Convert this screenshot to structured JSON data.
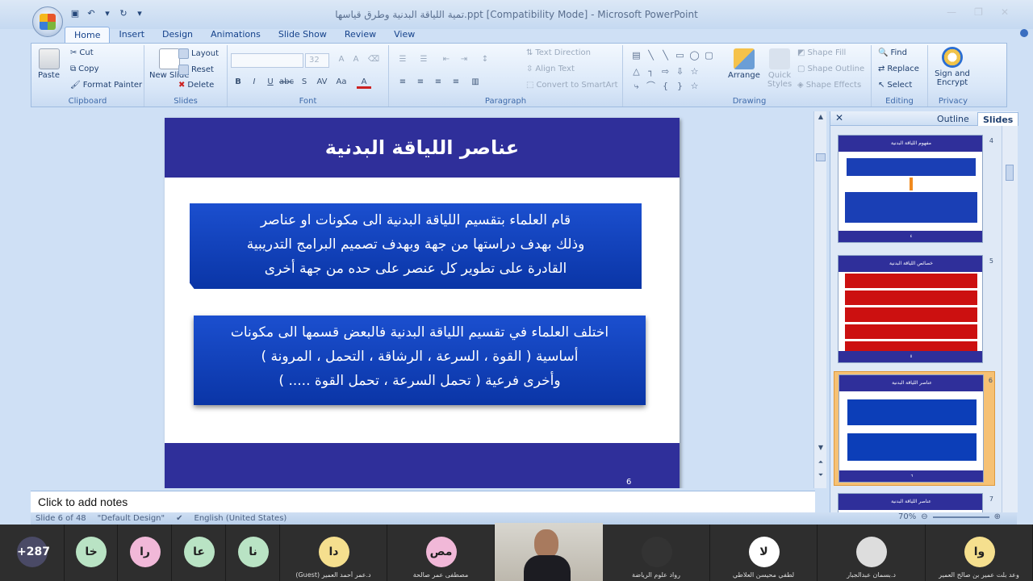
{
  "window": {
    "title": "تمية اللياقة البدنية وطرق قياسها.ppt [Compatibility Mode] - Microsoft PowerPoint"
  },
  "tabs": [
    "Home",
    "Insert",
    "Design",
    "Animations",
    "Slide Show",
    "Review",
    "View"
  ],
  "active_tab": "Home",
  "ribbon": {
    "clipboard": {
      "label": "Clipboard",
      "paste": "Paste",
      "cut": "Cut",
      "copy": "Copy",
      "format_painter": "Format Painter"
    },
    "slides": {
      "label": "Slides",
      "new_slide": "New Slide",
      "layout": "Layout",
      "reset": "Reset",
      "delete": "Delete"
    },
    "font": {
      "label": "Font",
      "size": "32"
    },
    "paragraph": {
      "label": "Paragraph",
      "text_direction": "Text Direction",
      "align_text": "Align Text",
      "convert_smartart": "Convert to SmartArt"
    },
    "drawing": {
      "label": "Drawing",
      "arrange": "Arrange",
      "quick_styles": "Quick Styles",
      "shape_fill": "Shape Fill",
      "shape_outline": "Shape Outline",
      "shape_effects": "Shape Effects"
    },
    "editing": {
      "label": "Editing",
      "find": "Find",
      "replace": "Replace",
      "select": "Select"
    },
    "privacy": {
      "label": "Privacy",
      "sign_encrypt": "Sign and Encrypt"
    }
  },
  "slide": {
    "title": "عناصر اللياقة البدنية",
    "box1_lines": [
      "قام العلماء بتقسيم اللياقة البدنية الى مكونات او عناصر",
      "وذلك بهدف دراستها من جهة وبهدف تصميم البرامج التدريبية",
      "القادرة على تطوير كل عنصر على حده  من جهة أخرى"
    ],
    "box2_lines": [
      "اختلف العلماء في تقسيم اللياقة البدنية فالبعض قسمها الى مكونات",
      "أساسية ( القوة ، السرعة ، الرشاقة ، التحمل ، المرونة )",
      "وأخرى فرعية  ( تحمل السرعة ، تحمل القوة .....  )"
    ],
    "number": "6"
  },
  "panel": {
    "tab_outline": "Outline",
    "tab_slides": "Slides",
    "thumbs": [
      {
        "num": "4",
        "title": "مفهوم اللياقة البدنية",
        "foot": "٤",
        "colors": [
          "#1a3fb5",
          "#1a3fb5"
        ]
      },
      {
        "num": "5",
        "title": "خصائص اللياقة البدنية",
        "foot": "٥",
        "colors": [
          "#cc1010",
          "#cc1010"
        ]
      },
      {
        "num": "6",
        "title": "عناصر اللياقة البدنية",
        "foot": "٦",
        "colors": [
          "#0c3eb8",
          "#0c3eb8"
        ]
      },
      {
        "num": "7",
        "title": "عناصر اللياقة البدنية",
        "foot": "",
        "colors": []
      }
    ]
  },
  "notes_placeholder": "Click to add notes",
  "status": {
    "slide_info": "Slide 6 of 48",
    "theme": "\"Default Design\"",
    "language": "English (United States)",
    "zoom": "70%"
  },
  "participants": [
    {
      "initials": "+287",
      "name": "",
      "color": "#4a4a66"
    },
    {
      "initials": "خا",
      "name": "",
      "color": "#b9e3c4"
    },
    {
      "initials": "را",
      "name": "",
      "color": "#f1b8d8"
    },
    {
      "initials": "عا",
      "name": "",
      "color": "#b9e3c4"
    },
    {
      "initials": "نا",
      "name": "",
      "color": "#b9e3c4"
    },
    {
      "initials": "دا",
      "name": "د.عمر أحمد العمير (Guest)",
      "color": "#f5df8e"
    },
    {
      "initials": "مص",
      "name": "مصطفى عمر صالحة",
      "color": "#f1b8d8"
    },
    {
      "initials": "",
      "name": "د.بسمان عبدالجبار",
      "color": ""
    },
    {
      "initials": "",
      "name": "رواد علوم الرياضة",
      "color": "#333"
    },
    {
      "initials": "لا",
      "name": "لطفي محيسن العلاطي",
      "color": "#fff"
    },
    {
      "initials": "",
      "name": "د.بسمان عبدالجبار",
      "color": "#ddd"
    },
    {
      "initials": "وا",
      "name": "وعد بلت عمير بن صالح العمير",
      "color": "#f5df8e"
    }
  ]
}
